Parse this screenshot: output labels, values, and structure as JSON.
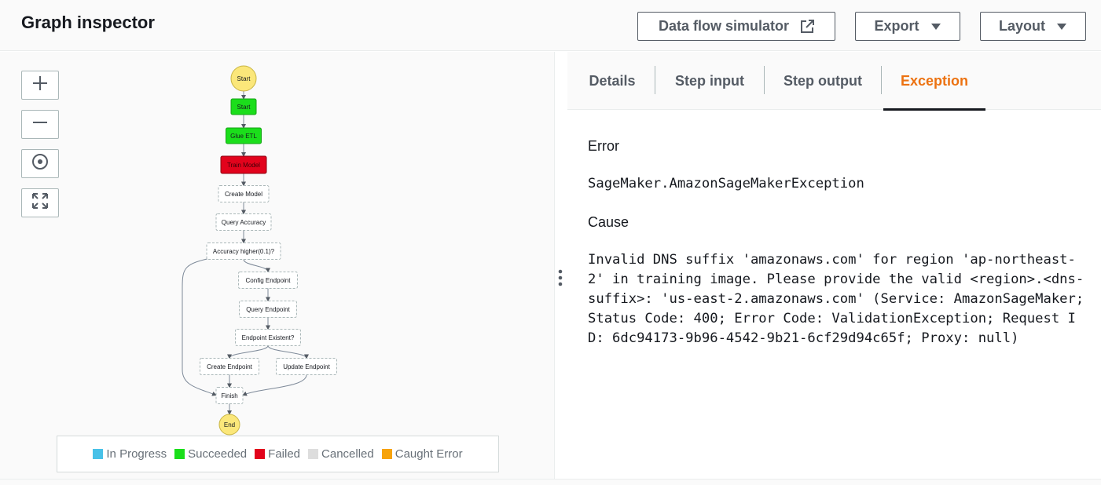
{
  "header": {
    "title": "Graph inspector",
    "buttons": {
      "simulator": "Data flow simulator",
      "export": "Export",
      "layout": "Layout"
    }
  },
  "zoom_controls": [
    "zoom-in",
    "zoom-out",
    "center",
    "fit-to-screen"
  ],
  "graph": {
    "nodes": [
      {
        "id": "start_circle",
        "label": "Start",
        "shape": "circle",
        "status": "start"
      },
      {
        "id": "start",
        "label": "Start",
        "shape": "rect",
        "status": "succeeded"
      },
      {
        "id": "glue",
        "label": "Glue ETL",
        "shape": "rect",
        "status": "succeeded"
      },
      {
        "id": "train",
        "label": "Train Model",
        "shape": "rect",
        "status": "failed"
      },
      {
        "id": "create_model",
        "label": "Create Model",
        "shape": "rect",
        "status": "not-run"
      },
      {
        "id": "query_acc",
        "label": "Query Accuracy",
        "shape": "rect",
        "status": "not-run"
      },
      {
        "id": "acc_higher",
        "label": "Accuracy higher(0.1)?",
        "shape": "rect",
        "status": "not-run"
      },
      {
        "id": "config_ep",
        "label": "Config Endpoint",
        "shape": "rect",
        "status": "not-run"
      },
      {
        "id": "query_ep",
        "label": "Query Endpoint",
        "shape": "rect",
        "status": "not-run"
      },
      {
        "id": "ep_exist",
        "label": "Endpoint Existent?",
        "shape": "rect",
        "status": "not-run"
      },
      {
        "id": "create_ep",
        "label": "Create Endpoint",
        "shape": "rect",
        "status": "not-run"
      },
      {
        "id": "update_ep",
        "label": "Update Endpoint",
        "shape": "rect",
        "status": "not-run"
      },
      {
        "id": "finish",
        "label": "Finish",
        "shape": "rect",
        "status": "not-run"
      },
      {
        "id": "end_circle",
        "label": "End",
        "shape": "circle",
        "status": "end"
      }
    ],
    "edges": [
      [
        "start_circle",
        "start"
      ],
      [
        "start",
        "glue"
      ],
      [
        "glue",
        "train"
      ],
      [
        "train",
        "create_model"
      ],
      [
        "create_model",
        "query_acc"
      ],
      [
        "query_acc",
        "acc_higher"
      ],
      [
        "acc_higher",
        "config_ep"
      ],
      [
        "acc_higher",
        "finish"
      ],
      [
        "config_ep",
        "query_ep"
      ],
      [
        "query_ep",
        "ep_exist"
      ],
      [
        "ep_exist",
        "create_ep"
      ],
      [
        "ep_exist",
        "update_ep"
      ],
      [
        "create_ep",
        "finish"
      ],
      [
        "update_ep",
        "finish"
      ],
      [
        "finish",
        "end_circle"
      ]
    ]
  },
  "legend": [
    {
      "label": "In Progress",
      "color": "#48c1e8"
    },
    {
      "label": "Succeeded",
      "color": "#1bde1b"
    },
    {
      "label": "Failed",
      "color": "#e2031c"
    },
    {
      "label": "Cancelled",
      "color": "#dddddd"
    },
    {
      "label": "Caught Error",
      "color": "#f7a30b"
    }
  ],
  "tabs": [
    {
      "label": "Details",
      "active": false
    },
    {
      "label": "Step input",
      "active": false
    },
    {
      "label": "Step output",
      "active": false
    },
    {
      "label": "Exception",
      "active": true
    }
  ],
  "exception": {
    "error_label": "Error",
    "error_value": "SageMaker.AmazonSageMakerException",
    "cause_label": "Cause",
    "cause_value": "Invalid DNS suffix 'amazonaws.com' for region 'ap-northeast-2' in training image. Please provide the valid <region>.<dns-suffix>: 'us-east-2.amazonaws.com' (Service: AmazonSageMaker; Status Code: 400; Error Code: ValidationException; Request ID: 6dc94173-9b96-4542-9b21-6cf29d94c65f; Proxy: null)"
  },
  "colors": {
    "accent": "#ec7211",
    "succeeded": "#1bde1b",
    "failed": "#e2031c",
    "terminal": "#fbe77a"
  }
}
